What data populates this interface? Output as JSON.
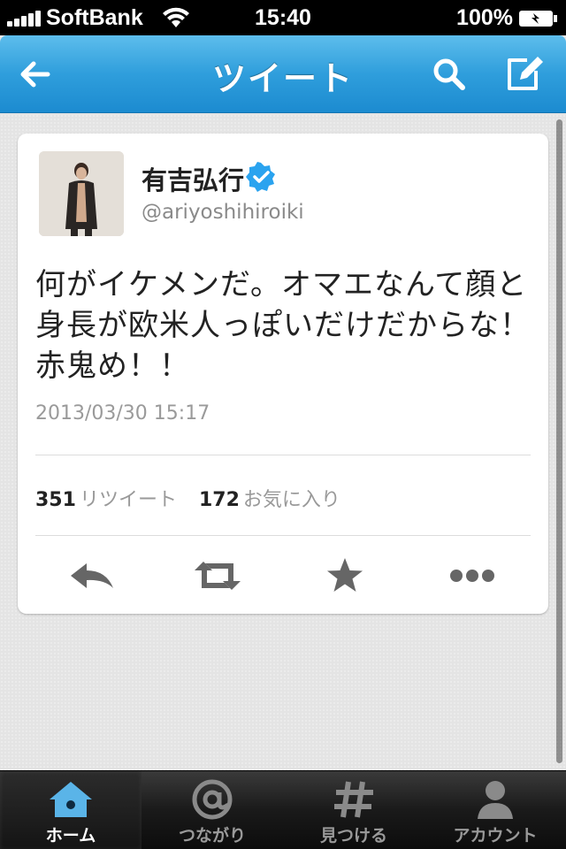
{
  "status_bar": {
    "carrier": "SoftBank",
    "time": "15:40",
    "battery": "100%",
    "icons": [
      "signal-icon",
      "wifi-icon",
      "battery-icon"
    ]
  },
  "nav": {
    "title": "ツイート",
    "icons": [
      "back-arrow-icon",
      "search-icon",
      "compose-icon"
    ]
  },
  "tweet": {
    "user_name": "有吉弘行",
    "handle": "@ariyoshihiroiki",
    "verified": true,
    "text": "何がイケメンだ。オマエなんて顔と身長が欧米人っぽいだけだからな！赤鬼め！！",
    "timestamp": "2013/03/30 15:17",
    "retweet_count": "351",
    "retweet_label": "リツイート",
    "favorite_count": "172",
    "favorite_label": "お気に入り",
    "actions": [
      "reply-icon",
      "retweet-icon",
      "star-icon",
      "more-icon"
    ]
  },
  "tab_bar": {
    "tabs": [
      {
        "label": "ホーム",
        "icon": "home-icon",
        "active": true
      },
      {
        "label": "つながり",
        "icon": "at-icon",
        "active": false
      },
      {
        "label": "見つける",
        "icon": "hash-icon",
        "active": false
      },
      {
        "label": "アカウント",
        "icon": "person-icon",
        "active": false
      }
    ]
  },
  "colors": {
    "nav_blue": "#2f9edc",
    "verified_blue": "#2aa3ef",
    "active_tab_icon": "#5ab4e8"
  }
}
